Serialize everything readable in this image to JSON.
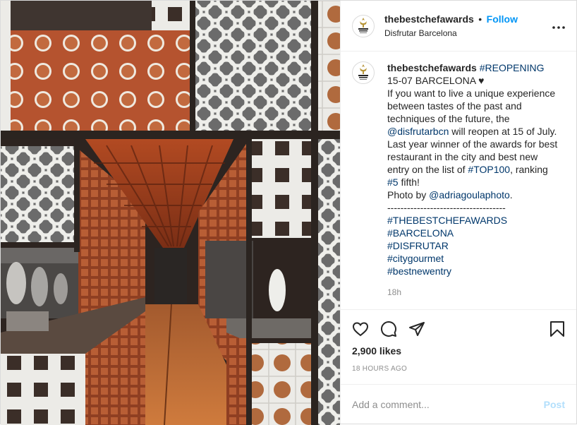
{
  "post": {
    "username": "thebestchefawards",
    "follow_label": "Follow",
    "separator": "•",
    "location": "Disfrutar Barcelona",
    "photo_alt": "Disfrutar Barcelona restaurant kitchen with brick and tile walls"
  },
  "caption": {
    "username": "thebestchefawards",
    "parts": [
      {
        "type": "link",
        "text": "#REOPENING"
      },
      {
        "type": "text",
        "text": "\n15-07 BARCELONA ♥\nIf you want to live a unique experience between tastes of the past and techniques of the future, the "
      },
      {
        "type": "link",
        "text": "@disfrutarbcn"
      },
      {
        "type": "text",
        "text": " will reopen at 15 of July. Last year winner of the awards for best restaurant in the city and best new entry on the list of "
      },
      {
        "type": "link",
        "text": "#TOP100"
      },
      {
        "type": "text",
        "text": ", ranking "
      },
      {
        "type": "link",
        "text": "#5"
      },
      {
        "type": "text",
        "text": " fifth!\nPhoto by "
      },
      {
        "type": "link",
        "text": "@adriagoulaphoto"
      },
      {
        "type": "text",
        "text": ".\n------------------------------------\n"
      },
      {
        "type": "link",
        "text": "#THEBESTCHEFAWARDS"
      },
      {
        "type": "text",
        "text": "\n"
      },
      {
        "type": "link",
        "text": "#BARCELONA"
      },
      {
        "type": "text",
        "text": "\n"
      },
      {
        "type": "link",
        "text": "#DISFRUTAR"
      },
      {
        "type": "text",
        "text": "\n"
      },
      {
        "type": "link",
        "text": "#citygourmet"
      },
      {
        "type": "text",
        "text": "\n"
      },
      {
        "type": "link",
        "text": "#bestnewentry"
      }
    ],
    "time": "18h"
  },
  "engagement": {
    "likes": "2,900 likes",
    "time_ago": "18 HOURS AGO"
  },
  "comment_box": {
    "placeholder": "Add a comment...",
    "post_label": "Post"
  },
  "colors": {
    "link": "#00376b",
    "follow": "#0095f6",
    "post_disabled": "#b2dffc",
    "brick": "#b5532f",
    "tile": "#e8e6e1"
  },
  "icons": [
    "logo-icon",
    "more-icon",
    "heart-icon",
    "comment-icon",
    "share-icon",
    "bookmark-icon"
  ]
}
